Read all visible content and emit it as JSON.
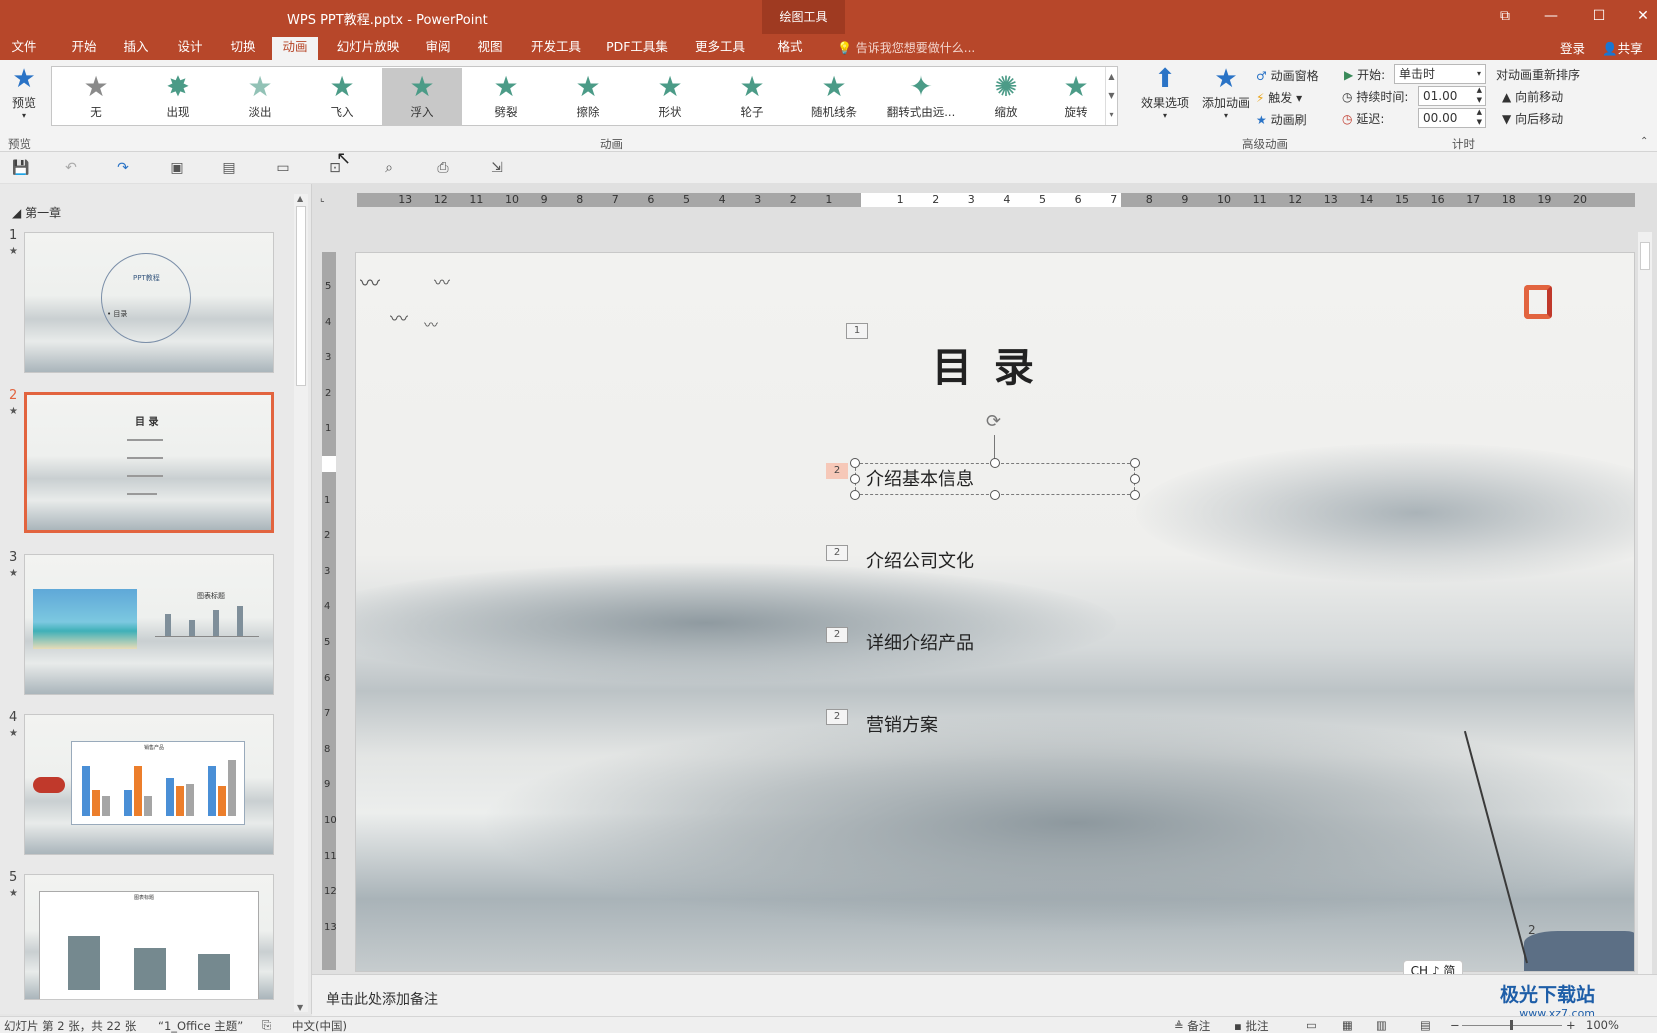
{
  "window": {
    "title": "WPS PPT教程.pptx - PowerPoint",
    "context_tool": "绘图工具",
    "share": "共享",
    "login": "登录"
  },
  "tabs": [
    {
      "label": "文件"
    },
    {
      "label": "开始"
    },
    {
      "label": "插入"
    },
    {
      "label": "设计"
    },
    {
      "label": "切换"
    },
    {
      "label": "动画",
      "active": true
    },
    {
      "label": "幻灯片放映"
    },
    {
      "label": "审阅"
    },
    {
      "label": "视图"
    },
    {
      "label": "开发工具"
    },
    {
      "label": "PDF工具集"
    },
    {
      "label": "更多工具"
    },
    {
      "label": "格式"
    }
  ],
  "tellme": "告诉我您想要做什么...",
  "ribbon": {
    "preview_label": "预览",
    "preview_group": "预览",
    "animations_group": "动画",
    "advanced_group": "高级动画",
    "timing_group": "计时",
    "gallery": [
      {
        "label": "无",
        "icon": "star-gray"
      },
      {
        "label": "出现",
        "icon": "star-burst"
      },
      {
        "label": "淡出",
        "icon": "star-faded"
      },
      {
        "label": "飞入",
        "icon": "star-fly"
      },
      {
        "label": "浮入",
        "icon": "star-float",
        "selected": true
      },
      {
        "label": "劈裂",
        "icon": "star-split"
      },
      {
        "label": "擦除",
        "icon": "star-wipe"
      },
      {
        "label": "形状",
        "icon": "star-shape"
      },
      {
        "label": "轮子",
        "icon": "star-wheel"
      },
      {
        "label": "随机线条",
        "icon": "star-lines"
      },
      {
        "label": "翻转式由远...",
        "icon": "star-flip"
      },
      {
        "label": "缩放",
        "icon": "star-zoom"
      },
      {
        "label": "旋转",
        "icon": "star-spin"
      }
    ],
    "effect_options": "效果选项",
    "add_animation": "添加动画",
    "animation_pane": "动画窗格",
    "trigger": "触发",
    "animation_painter": "动画刷",
    "start_label": "开始:",
    "start_value": "单击时",
    "duration_label": "持续时间:",
    "duration_value": "01.00",
    "delay_label": "延迟:",
    "delay_value": "00.00",
    "reorder_title": "对动画重新排序",
    "move_earlier": "向前移动",
    "move_later": "向后移动"
  },
  "slides_pane": {
    "section": "第一章",
    "slides": [
      {
        "num": "1",
        "text": "PPT教程",
        "text2": "• 目录"
      },
      {
        "num": "2",
        "text": "目 录",
        "selected": true
      },
      {
        "num": "3",
        "text": "图表标题"
      },
      {
        "num": "4",
        "text": "销售产品"
      },
      {
        "num": "5",
        "text": "图表标题"
      }
    ]
  },
  "ruler": {
    "h_left": [
      "13",
      "12",
      "11",
      "10",
      "9",
      "8",
      "7",
      "6",
      "5",
      "4",
      "3",
      "2",
      "1"
    ],
    "h_right": [
      "1",
      "2",
      "3",
      "4",
      "5",
      "6",
      "7",
      "8",
      "9",
      "10",
      "11",
      "12",
      "13",
      "14",
      "15",
      "16",
      "17",
      "18",
      "19",
      "20"
    ],
    "v_top": [
      "5",
      "4",
      "3",
      "2",
      "1"
    ],
    "v_bottom": [
      "1",
      "2",
      "3",
      "4",
      "5",
      "6",
      "7",
      "8",
      "9",
      "10",
      "11",
      "12",
      "13"
    ]
  },
  "slide": {
    "title": "目 录",
    "title_tag": "1",
    "items": [
      {
        "tag": "2",
        "text": "介绍基本信息",
        "hot": true
      },
      {
        "tag": "2",
        "text": "介绍公司文化"
      },
      {
        "tag": "2",
        "text": "详细介绍产品"
      },
      {
        "tag": "2",
        "text": "营销方案"
      }
    ],
    "page_number": "2"
  },
  "notes_placeholder": "单击此处添加备注",
  "ime": "CH ♪ 简",
  "status": {
    "slide_info": "幻灯片 第 2 张，共 22 张",
    "theme": "“1_Office 主题”",
    "language": "中文(中国)",
    "notes": "备注",
    "comments": "批注",
    "zoom": "100%"
  },
  "watermark": {
    "name": "极光下载站",
    "url": "www.xz7.com"
  }
}
